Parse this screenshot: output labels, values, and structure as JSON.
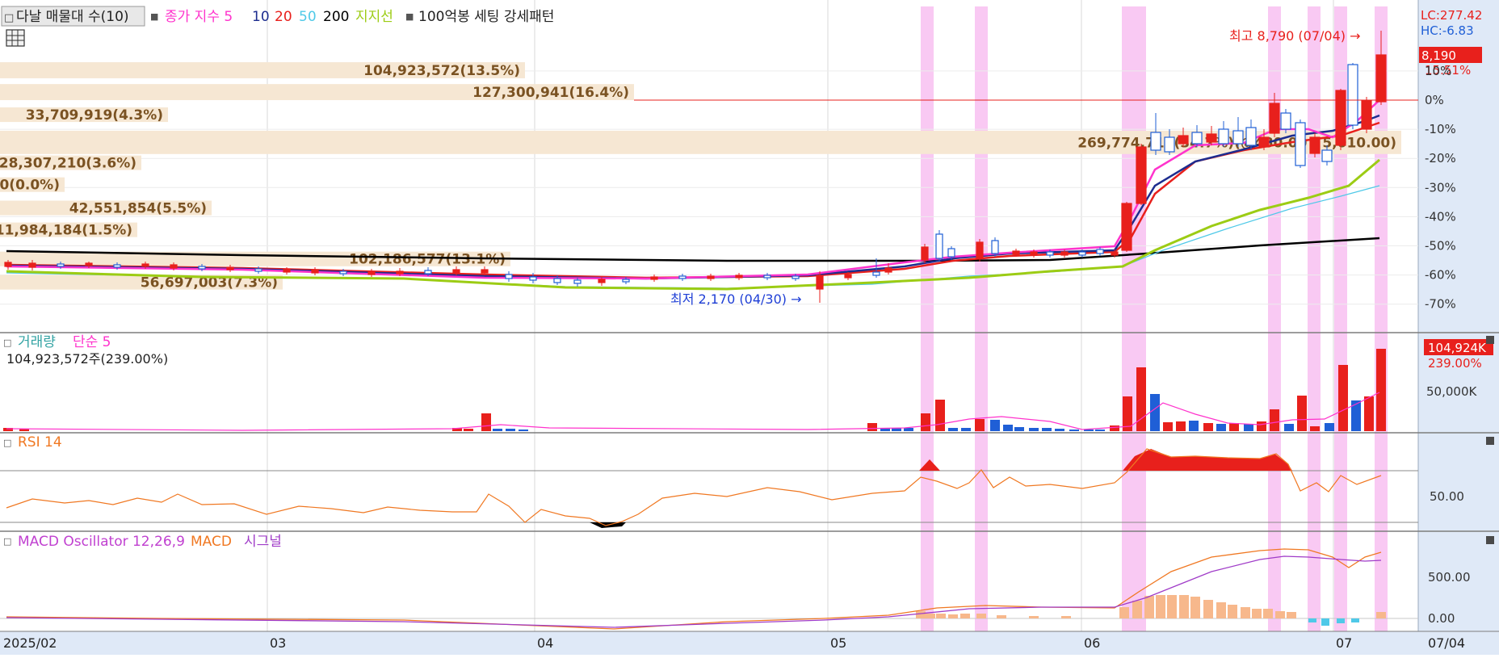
{
  "top_panel": {
    "legend_prefix": "□",
    "volume_profile_label": "다날 매물대 수(10)",
    "ma_square": "■",
    "ma_label": "종가 지수 5",
    "ma10": "10",
    "ma20": "20",
    "ma50": "50",
    "ma200": "200",
    "support_label": "지지선",
    "pattern_square": "■",
    "pattern_label": "100억봉 세팅 강세패턴",
    "lc_readout": "LC:277.42",
    "hc_readout": "HC:-6.83",
    "price_tag": "8,190",
    "pct_tag": "15.51%",
    "high_note": "최고 8,790 (07/04) →",
    "low_note": "최저 2,170 (04/30) →",
    "axis_ticks": [
      "10%",
      "0%",
      "-10%",
      "-20%",
      "-30%",
      "-40%",
      "-50%",
      "-60%",
      "-70%"
    ]
  },
  "volume_panel": {
    "prefix": "□",
    "title": "거래량",
    "sma_label": "단순 5",
    "readout": "104,923,572주(239.00%)",
    "tag_value": "104,924K",
    "tag_pct": "239.00%",
    "axis_tick": "50,000K"
  },
  "rsi_panel": {
    "prefix": "□",
    "title": "RSI 14",
    "axis_tick": "50.00"
  },
  "macd_panel": {
    "prefix": "□",
    "osc_label": "MACD Oscillator 12,26,9",
    "macd_label": "MACD",
    "signal_label": "시그널",
    "axis_ticks": [
      "500.00",
      "0.00"
    ]
  },
  "x_axis": {
    "labels": [
      "2025/02",
      "03",
      "04",
      "05",
      "06",
      "07"
    ],
    "current": "07/04"
  },
  "colors": {
    "up": "#e8201c",
    "down": "#1f5fd6",
    "ma5": "#ff33cc",
    "ma10": "#1d2d8f",
    "ma20": "#e8201c",
    "ma50": "#4fc9e8",
    "ma200": "#000000",
    "support": "#9ccc14",
    "highlight": "#f9c9f3",
    "profile": "#f6e7d3",
    "profile_text": "#7a5222",
    "axis_bg": "#dfe9f7",
    "rsi": "#f07822",
    "macd_osc": "#f7b88c",
    "signal": "#a03cc8"
  },
  "chart_data": [
    {
      "type": "candlestick",
      "title": "",
      "y_axis_unit": "% from latest close",
      "ylim_pct": [
        -75,
        12
      ],
      "highlight_dates": [
        "05/12",
        "05/19",
        "06/05",
        "06/06",
        "06/24",
        "06/30",
        "07/02",
        "07/04"
      ],
      "volume_profile": [
        {
          "pct_from": 7.5,
          "pct_to": 13.0,
          "label": "104,923,572(13.5%)"
        },
        {
          "pct_from": 0,
          "pct_to": 5.5,
          "label": "127,300,941(16.4%)"
        },
        {
          "pct_from": -7.5,
          "pct_to": -2.5,
          "label": "33,709,919(4.3%)"
        },
        {
          "pct_from": -18.5,
          "pct_to": -10.5,
          "label": "269,774,715(34.7%)(@480.00 - 5,010.00)"
        },
        {
          "pct_from": -24,
          "pct_to": -19,
          "label": "28,307,210(3.6%)"
        },
        {
          "pct_from": -31.5,
          "pct_to": -26.5,
          "label": "0(0.0%)"
        },
        {
          "pct_from": -39.5,
          "pct_to": -34.5,
          "label": "42,551,854(5.5%)"
        },
        {
          "pct_from": -47,
          "pct_to": -42,
          "label": "11,984,184(1.5%)"
        },
        {
          "pct_from": -57,
          "pct_to": -52,
          "label": "102,186,577(13.1%)"
        },
        {
          "pct_from": -65,
          "pct_to": -60,
          "label": "56,697,003(7.3%)"
        }
      ],
      "marker_high": {
        "date": "07/04",
        "pct": 7.2
      },
      "marker_low": {
        "date": "04/30",
        "pct": -73.5
      },
      "reference_line_pct": 0,
      "candles_pct_approx": [
        [
          "05/12",
          -51,
          -55,
          -50,
          -58
        ],
        [
          "05/14",
          -47,
          -54,
          -46,
          -55
        ],
        [
          "05/19",
          -49,
          -55,
          -48,
          -56
        ],
        [
          "06/04",
          -35,
          -51,
          -32,
          -53
        ],
        [
          "06/05",
          -17,
          -35,
          -16,
          -36
        ],
        [
          "06/06",
          -16,
          -12,
          -5,
          -20
        ],
        [
          "06/24",
          -10,
          -1,
          2,
          -12
        ],
        [
          "06/30",
          -14,
          -19,
          -12,
          -22
        ],
        [
          "07/01",
          -17,
          -2,
          10,
          -19
        ],
        [
          "07/02",
          1,
          -10,
          4,
          -12
        ],
        [
          "07/04",
          15.5,
          1,
          17.7,
          -2
        ]
      ],
      "candle_format": "[date, open, close, high, low] in % from latest close"
    },
    {
      "type": "bar",
      "title": "",
      "series": [
        {
          "name": "거래량",
          "values_k": [
            [
              "05/08",
              7000
            ],
            [
              "05/12",
              17000
            ],
            [
              "05/13",
              29000
            ],
            [
              "05/19",
              22000
            ],
            [
              "06/04",
              33000
            ],
            [
              "06/05",
              60000
            ],
            [
              "06/06",
              35000
            ],
            [
              "06/24",
              21000
            ],
            [
              "06/26",
              33000
            ],
            [
              "06/30",
              63000
            ],
            [
              "07/02",
              29000
            ],
            [
              "07/03",
              33000
            ],
            [
              "07/04",
              104924
            ]
          ]
        }
      ],
      "y_ticks": [
        "50,000K"
      ]
    },
    {
      "type": "line",
      "title": "",
      "series": [
        {
          "name": "RSI 14"
        }
      ],
      "levels": [
        70,
        30
      ],
      "y_ticks": [
        "50.00"
      ]
    },
    {
      "type": "line",
      "title": "",
      "series": [
        {
          "name": "MACD Oscillator 12,26,9"
        },
        {
          "name": "MACD"
        },
        {
          "name": "시그널"
        }
      ],
      "y_ticks": [
        "500.00",
        "0.00"
      ]
    }
  ]
}
